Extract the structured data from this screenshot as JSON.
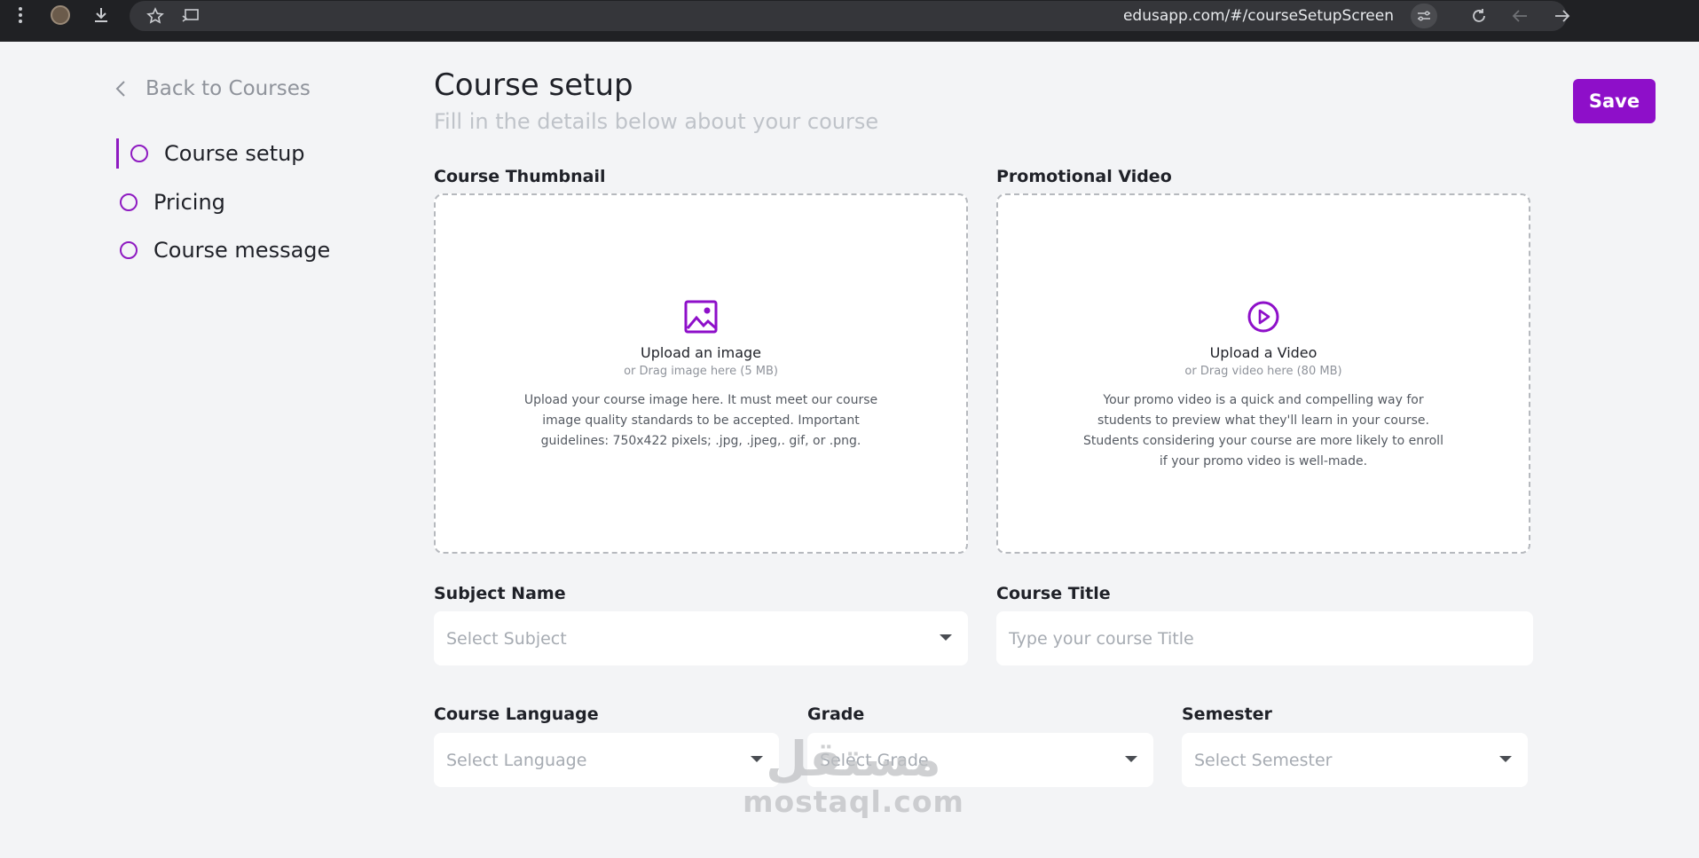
{
  "browser": {
    "url": "edusapp.com/#/courseSetupScreen"
  },
  "sidebar": {
    "back_label": "Back to Courses",
    "items": [
      {
        "label": "Course setup",
        "active": true
      },
      {
        "label": "Pricing",
        "active": false
      },
      {
        "label": "Course message",
        "active": false
      }
    ]
  },
  "header": {
    "title": "Course setup",
    "subtitle": "Fill in the details below about your course",
    "save_label": "Save"
  },
  "thumbnail": {
    "label": "Course Thumbnail",
    "title": "Upload an image",
    "hint": "or Drag image here (5 MB)",
    "description": "Upload your course image here. It must meet our course image quality standards to be accepted. Important guidelines: 750x422 pixels; .jpg, .jpeg,. gif, or .png."
  },
  "video": {
    "label": "Promotional Video",
    "title": "Upload a Video",
    "hint": "or Drag video here (80 MB)",
    "description": "Your promo video is a quick and compelling way for students to preview what they'll learn in your course. Students considering your course are more likely to enroll if your promo video is well-made."
  },
  "form": {
    "subject": {
      "label": "Subject Name",
      "placeholder": "Select Subject"
    },
    "title": {
      "label": "Course Title",
      "placeholder": "Type your course Title"
    },
    "language": {
      "label": "Course Language",
      "placeholder": "Select Language"
    },
    "grade": {
      "label": "Grade",
      "placeholder": "Select Grade"
    },
    "semester": {
      "label": "Semester",
      "placeholder": "Select Semester"
    }
  },
  "watermark": {
    "arabic": "مستقل",
    "latin": "mostaql.com"
  },
  "colors": {
    "accent": "#8e0fc9",
    "topbar": "#202124",
    "background": "#f3f4f6"
  }
}
